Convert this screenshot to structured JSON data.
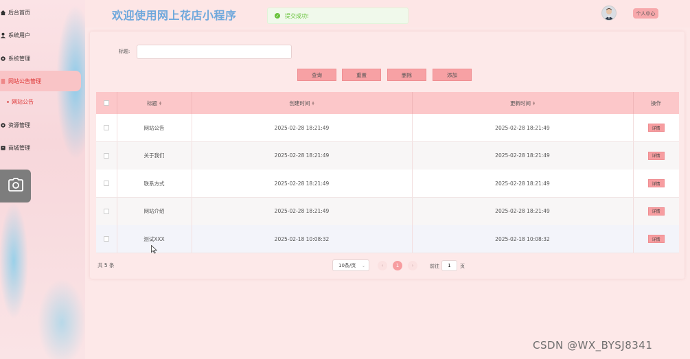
{
  "sidebar": {
    "items": [
      {
        "label": "后台首页",
        "icon": "home-icon"
      },
      {
        "label": "系统用户",
        "icon": "user-icon"
      },
      {
        "label": "系统管理",
        "icon": "gear-icon"
      },
      {
        "label": "网站公告管理",
        "icon": "document-icon"
      },
      {
        "label": "资源管理",
        "icon": "gear-icon"
      },
      {
        "label": "商城管理",
        "icon": "shop-icon"
      }
    ],
    "sub_item": "网站公告",
    "camera_icon": "camera-icon"
  },
  "header": {
    "title": "欢迎使用网上花店小程序",
    "toast": "提交成功!",
    "user_center": "个人中心"
  },
  "search": {
    "label": "标题:",
    "value": "",
    "placeholder": ""
  },
  "buttons": {
    "query": "查询",
    "reset": "重置",
    "delete": "删除",
    "add": "添加"
  },
  "table": {
    "columns": [
      "标题",
      "创建时间",
      "更新时间",
      "操作"
    ],
    "rows": [
      {
        "title": "网站公告",
        "created": "2025-02-28 18:21:49",
        "updated": "2025-02-28 18:21:49",
        "action": "详情"
      },
      {
        "title": "关于我们",
        "created": "2025-02-28 18:21:49",
        "updated": "2025-02-28 18:21:49",
        "action": "详情"
      },
      {
        "title": "联系方式",
        "created": "2025-02-28 18:21:49",
        "updated": "2025-02-28 18:21:49",
        "action": "详情"
      },
      {
        "title": "网站介绍",
        "created": "2025-02-28 18:21:49",
        "updated": "2025-02-28 18:21:49",
        "action": "详情"
      },
      {
        "title": "测试XXX",
        "created": "2025-02-18 10:08:32",
        "updated": "2025-02-18 10:08:32",
        "action": "详情"
      }
    ]
  },
  "pagination": {
    "total": "共 5 条",
    "page_size": "10条/页",
    "current_page": "1",
    "goto_label": "前往",
    "goto_value": "1",
    "goto_unit": "页"
  },
  "colors": {
    "accent": "#f7a1a4",
    "title": "#6fa8dc",
    "success": "#67c23a",
    "table_header": "#fcc7c9"
  },
  "watermark": "CSDN @WX_BYSJ8341"
}
